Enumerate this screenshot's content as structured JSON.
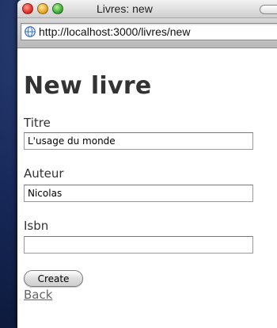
{
  "window": {
    "title": "Livres: new"
  },
  "browser": {
    "url": "http://localhost:3000/livres/new"
  },
  "page": {
    "heading": "New livre",
    "fields": [
      {
        "label": "Titre",
        "value": "L'usage du monde"
      },
      {
        "label": "Auteur",
        "value": "Nicolas"
      },
      {
        "label": "Isbn",
        "value": ""
      }
    ],
    "submit_label": "Create",
    "back_link": "Back"
  },
  "icons": {
    "address_icon": "globe-icon"
  },
  "colors": {
    "heading": "#333333",
    "link": "#666666",
    "desktop": "#17295a"
  }
}
